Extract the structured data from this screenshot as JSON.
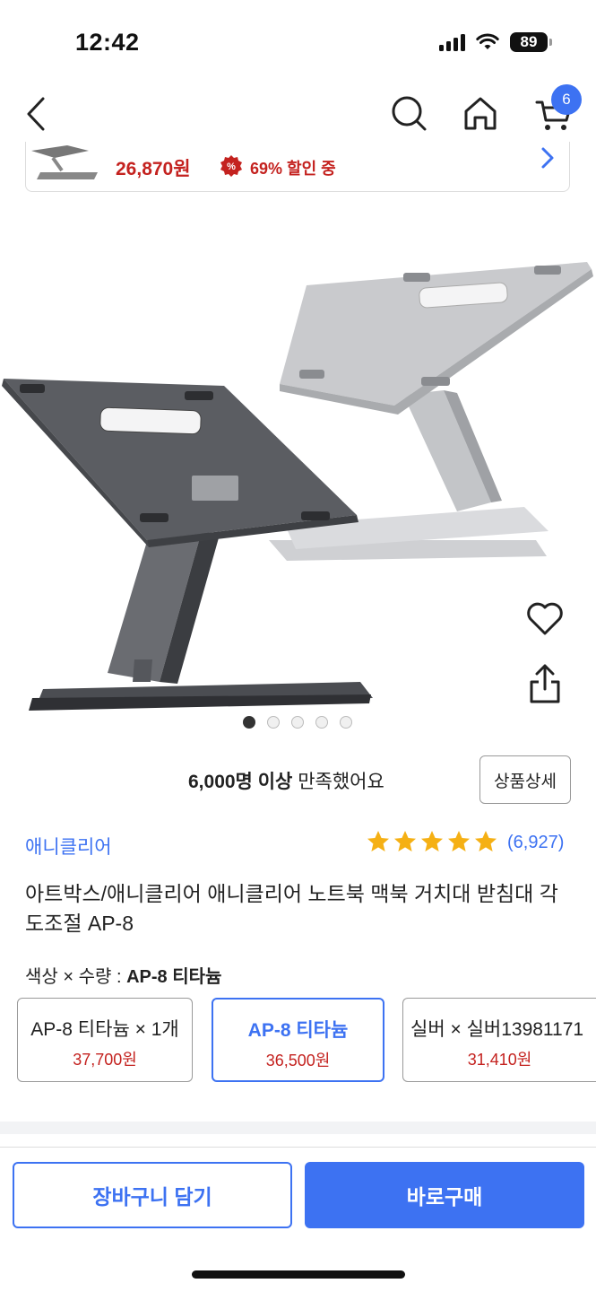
{
  "status_bar": {
    "time": "12:42",
    "battery": "89"
  },
  "nav": {
    "cart_count": "6"
  },
  "promo": {
    "price": "26,870원",
    "discount": "69% 할인 중",
    "badge": "%"
  },
  "gallery": {
    "image_count": 5,
    "active_index": 0
  },
  "satisfaction": {
    "count": "6,000명 이상",
    "text": " 만족했어요"
  },
  "detail_button": "상품상세",
  "brand": "애니클리어",
  "rating": {
    "stars": 5,
    "review_count": "(6,927)"
  },
  "title": "아트박스/애니클리어 애니클리어 노트북 맥북 거치대 받침대 각도조절 AP-8",
  "option": {
    "label": "색상 × 수량 : ",
    "selected": "AP-8 티타늄",
    "items": [
      {
        "name": "AP-8 티타늄 × 1개",
        "price": "37,700원"
      },
      {
        "name": "AP-8 티타늄",
        "price": "36,500원"
      },
      {
        "name": "실버 × 실버13981171",
        "price": "31,410원"
      }
    ]
  },
  "buttons": {
    "add_to_cart": "장바구니 담기",
    "buy_now": "바로구매"
  },
  "colors": {
    "accent": "#3d72f2",
    "price_red": "#c4221f"
  }
}
